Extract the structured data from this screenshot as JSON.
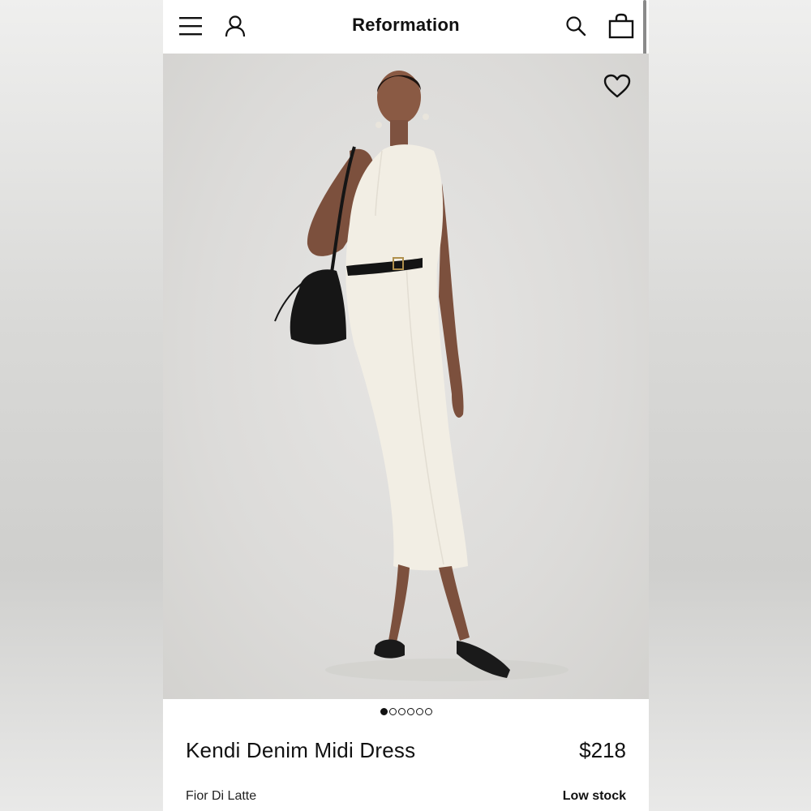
{
  "header": {
    "brand": "Reformation",
    "icons": [
      "menu-icon",
      "account-icon",
      "search-icon",
      "bag-icon"
    ]
  },
  "hero": {
    "favorite_icon": "heart-icon",
    "image_alt": "Model wearing the dress",
    "carousel": {
      "total": 6,
      "active": 1
    }
  },
  "product": {
    "name": "Kendi Denim Midi Dress",
    "price": "$218",
    "color": "Fior Di Latte",
    "stock_status": "Low stock"
  },
  "colors": {
    "text": "#111111",
    "hero_bg": "#dddcda",
    "page_bg": "#ffffff"
  }
}
